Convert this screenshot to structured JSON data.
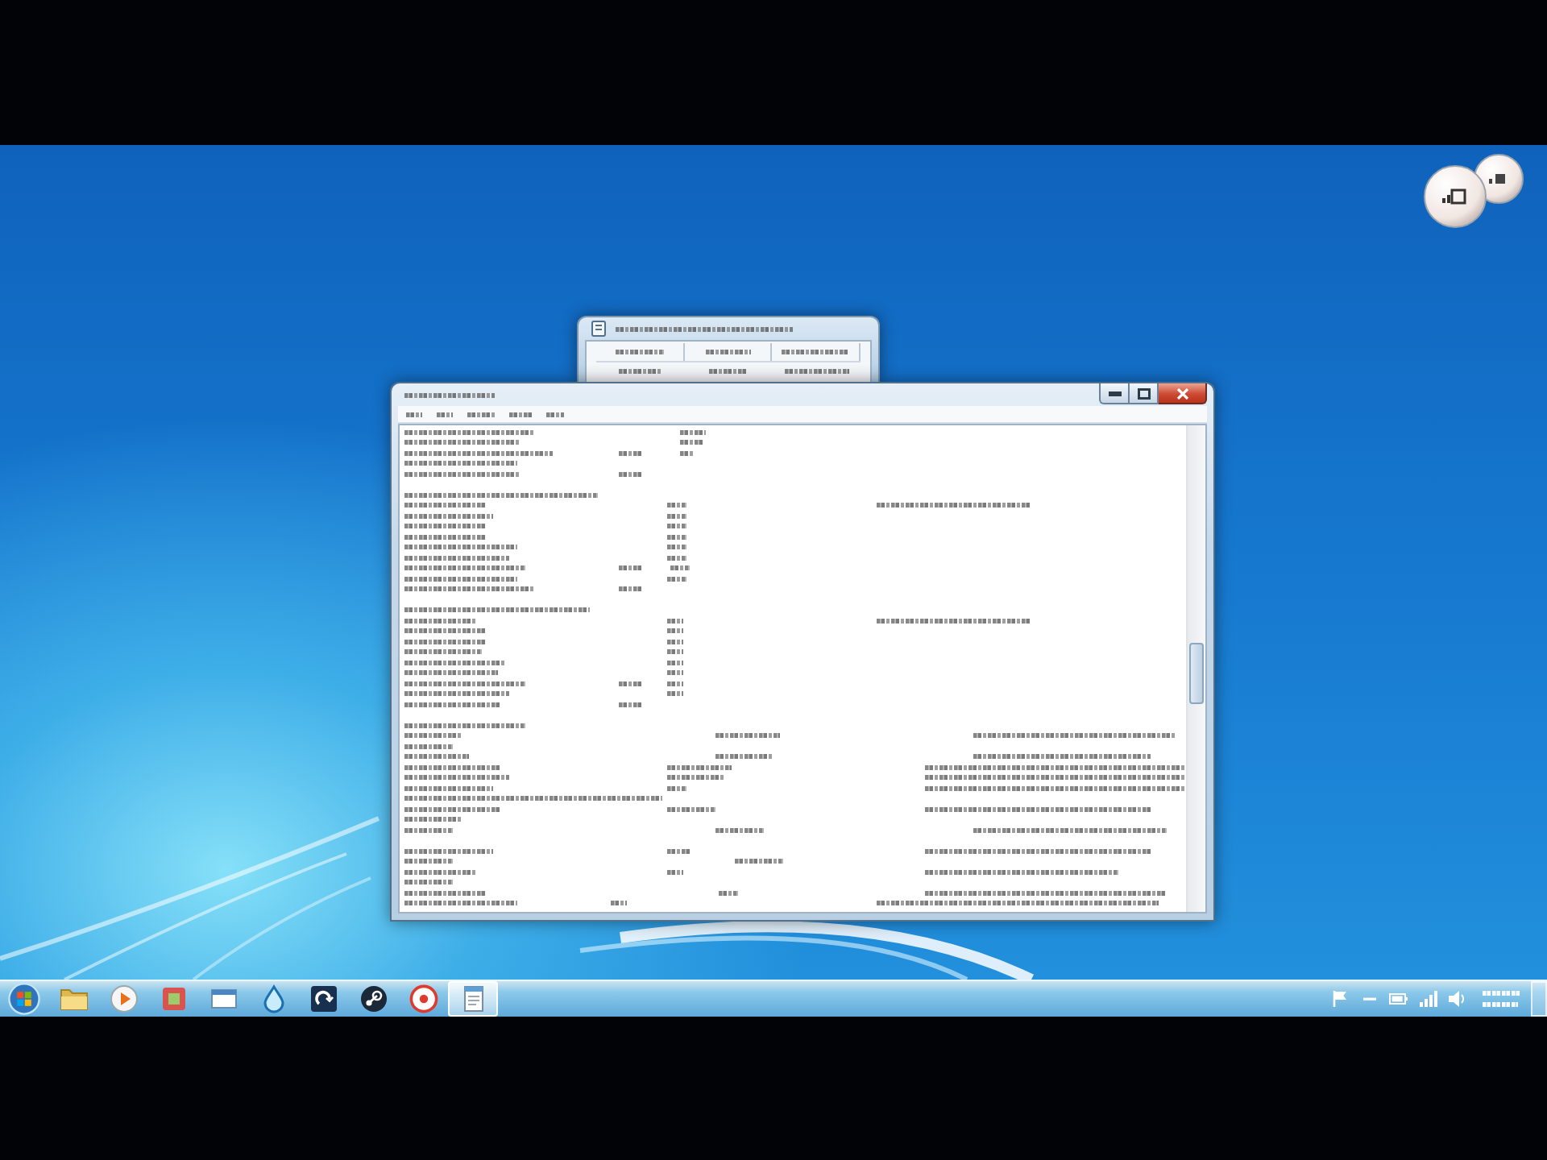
{
  "desktop": {
    "gadget": true
  },
  "windows": [
    {
      "kind": "dialog",
      "focused": false
    },
    {
      "kind": "notepad",
      "focused": true
    }
  ],
  "taskbar": {
    "buttons": [
      {
        "kind": "start",
        "selected": false
      },
      {
        "kind": "folder",
        "selected": false
      },
      {
        "kind": "media",
        "selected": false
      },
      {
        "kind": "tile",
        "selected": false
      },
      {
        "kind": "window",
        "selected": false
      },
      {
        "kind": "droplet",
        "selected": false
      },
      {
        "kind": "arrow",
        "selected": false
      },
      {
        "kind": "knot",
        "selected": false
      },
      {
        "kind": "target",
        "selected": false
      },
      {
        "kind": "notepad",
        "selected": true
      }
    ],
    "tray": [
      {
        "kind": "flag"
      },
      {
        "kind": "minus"
      },
      {
        "kind": "battery"
      },
      {
        "kind": "signal"
      },
      {
        "kind": "speaker"
      }
    ]
  }
}
